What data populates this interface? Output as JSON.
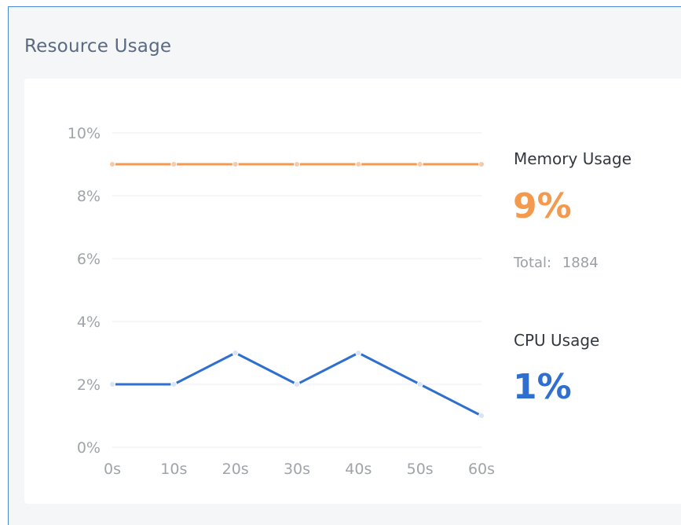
{
  "panel": {
    "title": "Resource Usage"
  },
  "stats": {
    "memory": {
      "label": "Memory Usage",
      "value": "9%",
      "total_label": "Total:",
      "total_value": "1884",
      "color": "#f39a4f"
    },
    "cpu": {
      "label": "CPU Usage",
      "value": "1%",
      "color": "#2e6fd0"
    }
  },
  "chart_data": {
    "type": "line",
    "title": "",
    "xlabel": "",
    "ylabel": "",
    "x": [
      "0s",
      "10s",
      "20s",
      "30s",
      "40s",
      "50s",
      "60s"
    ],
    "yticks": [
      "0%",
      "2%",
      "4%",
      "6%",
      "8%",
      "10%"
    ],
    "ylim": [
      0,
      10
    ],
    "grid": true,
    "legend": "none",
    "series": [
      {
        "key": "memory",
        "values": [
          9,
          9,
          9,
          9,
          9,
          9,
          9
        ],
        "color": "#f39a4f",
        "marker_color": "#f7c9a6"
      },
      {
        "key": "cpu",
        "values": [
          2,
          2,
          3,
          2,
          3,
          2,
          1
        ],
        "color": "#2e6fd0",
        "marker_color": "#d7e3f7"
      }
    ]
  }
}
